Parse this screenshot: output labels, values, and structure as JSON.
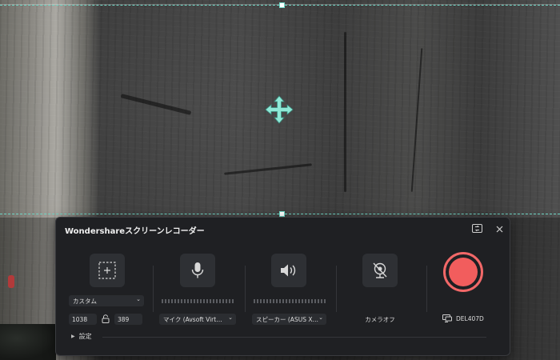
{
  "app": {
    "title": "Wondershareスクリーンレコーダー"
  },
  "capture": {
    "mode": "カスタム",
    "width": "1038",
    "height": "389"
  },
  "audio": {
    "microphone": "マイク (Avsoft Virt…",
    "speaker": "スピーカー (ASUS X…"
  },
  "camera": {
    "label": "カメラオフ"
  },
  "monitor": {
    "label": "DEL407D"
  },
  "settings": {
    "label": "設定"
  },
  "colors": {
    "accent": "#6fd6c5",
    "record": "#f25d5d",
    "panel_bg": "#1f2023"
  },
  "icons": {
    "region_move": "move-arrows-icon",
    "swap": "swap-screen-icon",
    "close": "close-icon",
    "area": "custom-area-icon",
    "mic": "microphone-icon",
    "speaker": "speaker-icon",
    "camera": "camera-off-icon",
    "monitor": "monitor-icon",
    "lock": "aspect-lock-icon"
  }
}
